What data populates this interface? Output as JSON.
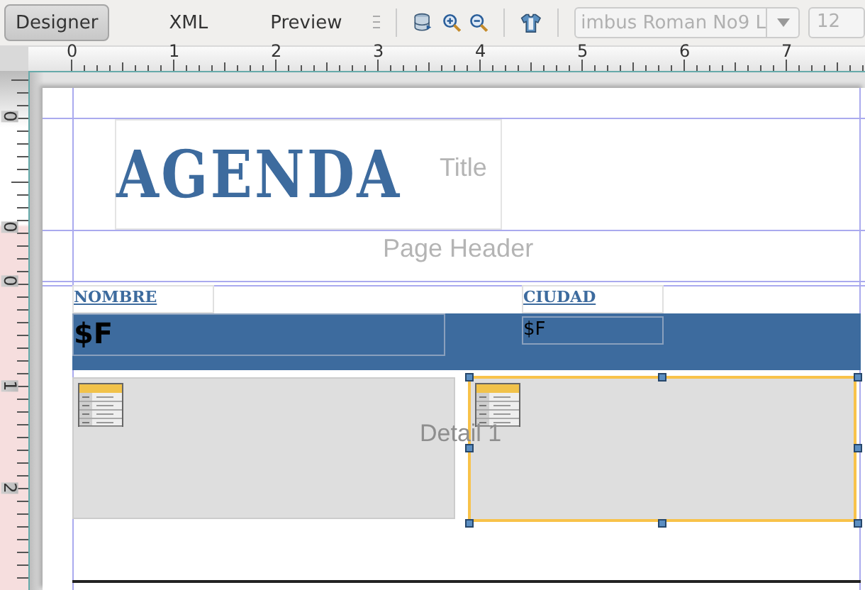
{
  "tabs": [
    {
      "label": "Designer",
      "selected": true
    },
    {
      "label": "XML",
      "selected": false
    },
    {
      "label": "Preview",
      "selected": false
    }
  ],
  "font_combo": {
    "value": "imbus Roman No9 L",
    "disabled": true
  },
  "size_field": {
    "value": "12",
    "disabled": true
  },
  "horizontal_ruler": [
    "0",
    "1",
    "2",
    "3",
    "4",
    "5",
    "6",
    "7"
  ],
  "vertical_ruler": [
    "0",
    "0",
    "0",
    "1",
    "2"
  ],
  "report": {
    "title": "AGENDA",
    "bands": [
      "Title",
      "Page Header",
      "Detail 1"
    ],
    "column_headers": [
      "NOMBRE",
      "CIUDAD"
    ],
    "fields": [
      "$F",
      "$F"
    ],
    "subreports": [
      {
        "selected": false
      },
      {
        "selected": true
      }
    ]
  }
}
